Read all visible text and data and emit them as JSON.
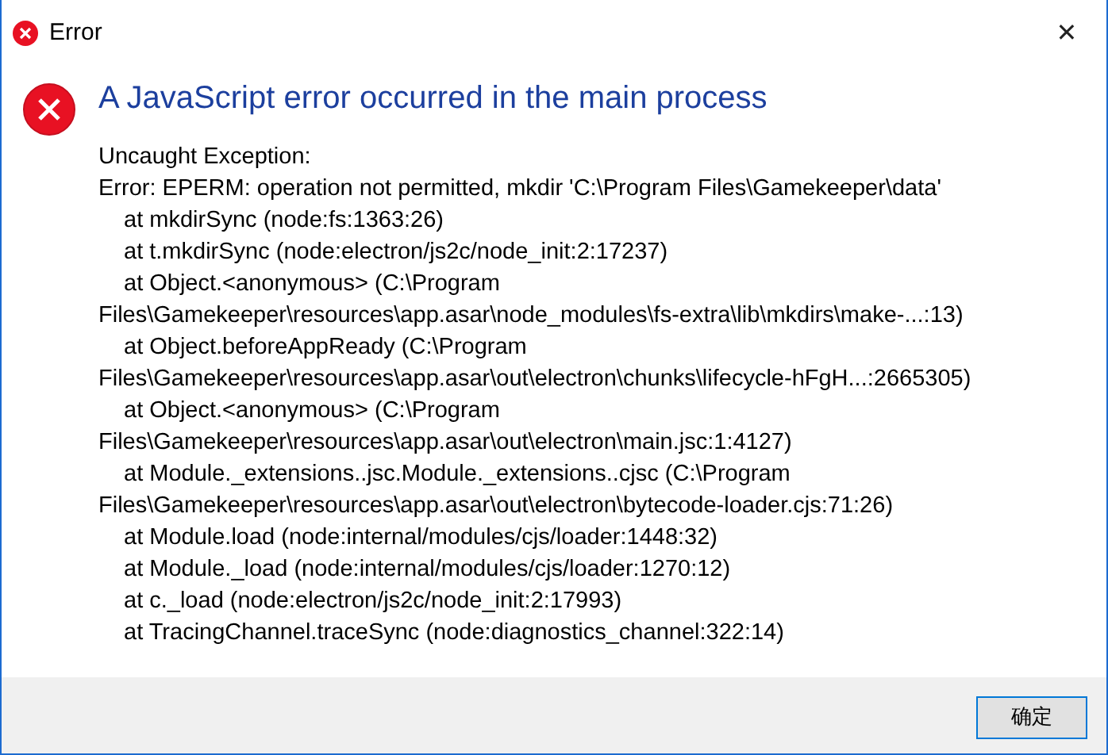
{
  "window": {
    "title": "Error",
    "close": "✕"
  },
  "heading": "A JavaScript error occurred in the main process",
  "lines": [
    {
      "text": "Uncaught Exception:",
      "indented": false
    },
    {
      "text": "Error: EPERM: operation not permitted, mkdir 'C:\\Program Files\\Gamekeeper\\data'",
      "indented": false
    },
    {
      "text": "at mkdirSync (node:fs:1363:26)",
      "indented": true
    },
    {
      "text": "at t.mkdirSync (node:electron/js2c/node_init:2:17237)",
      "indented": true
    },
    {
      "text": "at Object.<anonymous> (C:\\Program",
      "indented": true
    },
    {
      "text": "Files\\Gamekeeper\\resources\\app.asar\\node_modules\\fs-extra\\lib\\mkdirs\\make-...:13)",
      "indented": false
    },
    {
      "text": "at Object.beforeAppReady (C:\\Program",
      "indented": true
    },
    {
      "text": "Files\\Gamekeeper\\resources\\app.asar\\out\\electron\\chunks\\lifecycle-hFgH...:2665305)",
      "indented": false
    },
    {
      "text": "at Object.<anonymous> (C:\\Program",
      "indented": true
    },
    {
      "text": "Files\\Gamekeeper\\resources\\app.asar\\out\\electron\\main.jsc:1:4127)",
      "indented": false
    },
    {
      "text": "at Module._extensions..jsc.Module._extensions..cjsc (C:\\Program",
      "indented": true
    },
    {
      "text": "Files\\Gamekeeper\\resources\\app.asar\\out\\electron\\bytecode-loader.cjs:71:26)",
      "indented": false
    },
    {
      "text": "at Module.load (node:internal/modules/cjs/loader:1448:32)",
      "indented": true
    },
    {
      "text": "at Module._load (node:internal/modules/cjs/loader:1270:12)",
      "indented": true
    },
    {
      "text": "at c._load (node:electron/js2c/node_init:2:17993)",
      "indented": true
    },
    {
      "text": "at TracingChannel.traceSync (node:diagnostics_channel:322:14)",
      "indented": true
    }
  ],
  "buttons": [
    "确定"
  ]
}
